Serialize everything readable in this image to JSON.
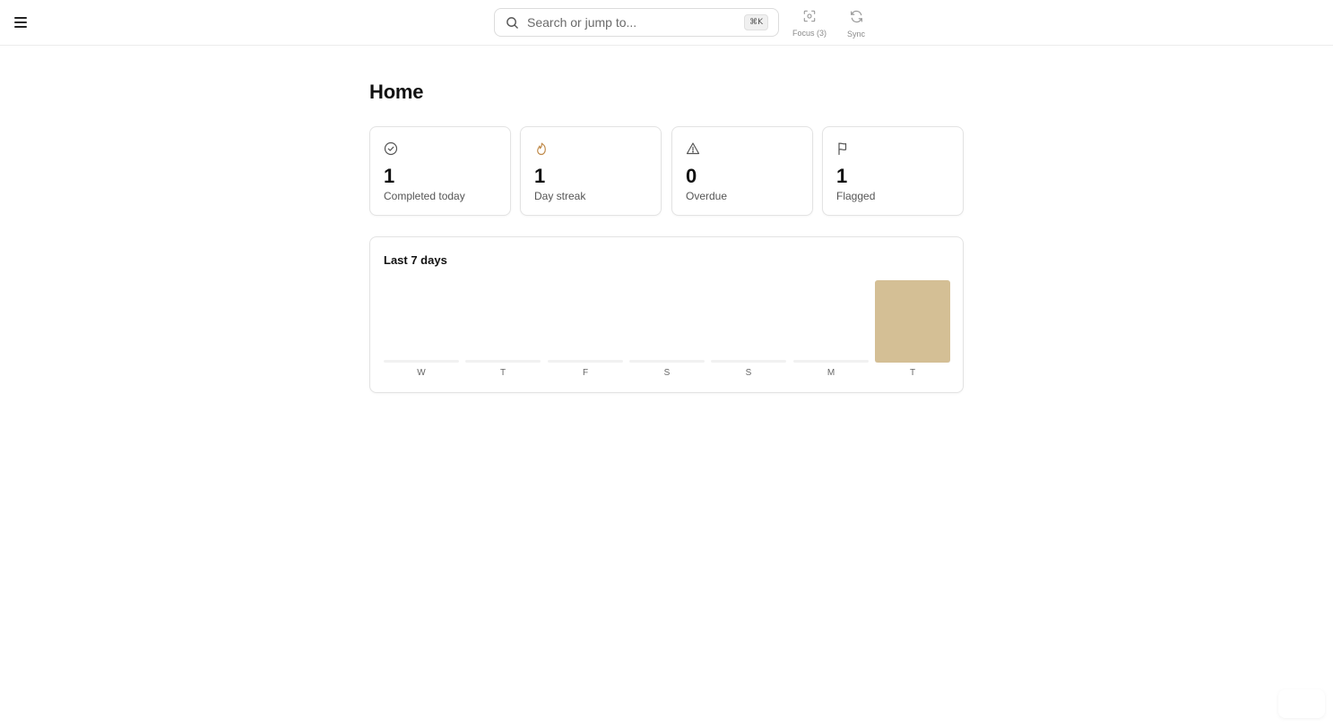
{
  "header": {
    "search": {
      "placeholder": "Search or jump to...",
      "shortcut": "⌘K",
      "icon": "search-icon"
    },
    "tools": [
      {
        "label": "Focus (3)",
        "icon": "focus-icon"
      },
      {
        "label": "Sync",
        "icon": "sync-icon"
      }
    ],
    "menu_icon": "menu-icon"
  },
  "main": {
    "title": "Home",
    "stats": [
      {
        "value": "1",
        "caption": "Completed today",
        "icon": "check-circle-icon"
      },
      {
        "value": "1",
        "caption": "Day streak",
        "icon": "flame-icon",
        "icon_color": "#c08a4a"
      },
      {
        "value": "0",
        "caption": "Overdue",
        "icon": "warning-icon"
      },
      {
        "value": "1",
        "caption": "Flagged",
        "icon": "flag-icon"
      }
    ],
    "chart": {
      "title": "Last 7 days"
    }
  },
  "colors": {
    "accent_bar": "#d4bf95",
    "border": "#e3e3e3"
  },
  "chart_data": {
    "type": "bar",
    "title": "Last 7 days",
    "categories": [
      "W",
      "T",
      "F",
      "S",
      "S",
      "M",
      "T"
    ],
    "values": [
      0,
      0,
      0,
      0,
      0,
      0,
      1
    ],
    "ylim": [
      0,
      1
    ],
    "grid": false
  }
}
